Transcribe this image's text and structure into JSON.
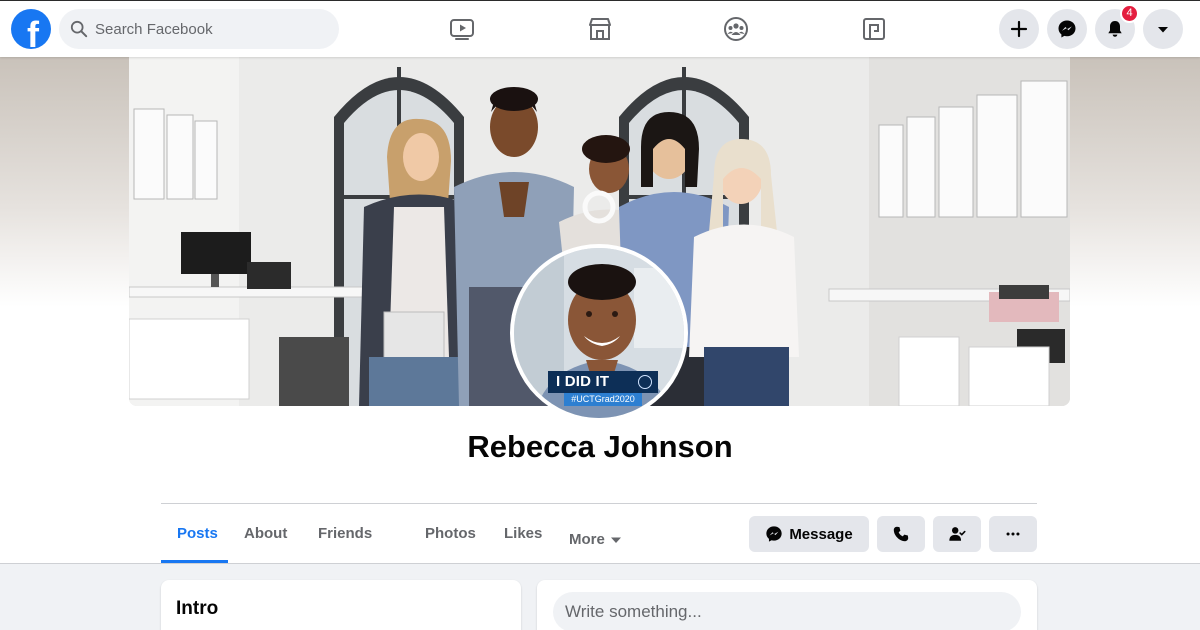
{
  "nav": {
    "search_placeholder": "Search Facebook",
    "notification_count": "4",
    "logo_letter": "f",
    "icons": [
      "watch-icon",
      "marketplace-icon",
      "groups-icon",
      "gaming-icon",
      "create-icon",
      "messenger-icon",
      "notifications-icon",
      "account-menu-icon"
    ]
  },
  "profile": {
    "name": "Rebecca Johnson",
    "frame_text": "I DID IT",
    "frame_hashtag": "#UCTGrad2020"
  },
  "tabs": [
    {
      "label": "Posts",
      "active": true
    },
    {
      "label": "About",
      "active": false
    },
    {
      "label": "Friends",
      "active": false
    },
    {
      "label": "Photos",
      "active": false
    },
    {
      "label": "Likes",
      "active": false
    },
    {
      "label": "More",
      "active": false
    }
  ],
  "actions": {
    "message_label": "Message",
    "icons": [
      "messenger-icon",
      "phone-icon",
      "friend-status-icon",
      "more-options-icon"
    ]
  },
  "intro": {
    "title": "Intro"
  },
  "composer": {
    "placeholder": "Write something..."
  },
  "colors": {
    "brand": "#1877f2",
    "badge": "#e41e3f",
    "button_bg": "#e4e6eb",
    "page_bg": "#f0f2f5"
  }
}
